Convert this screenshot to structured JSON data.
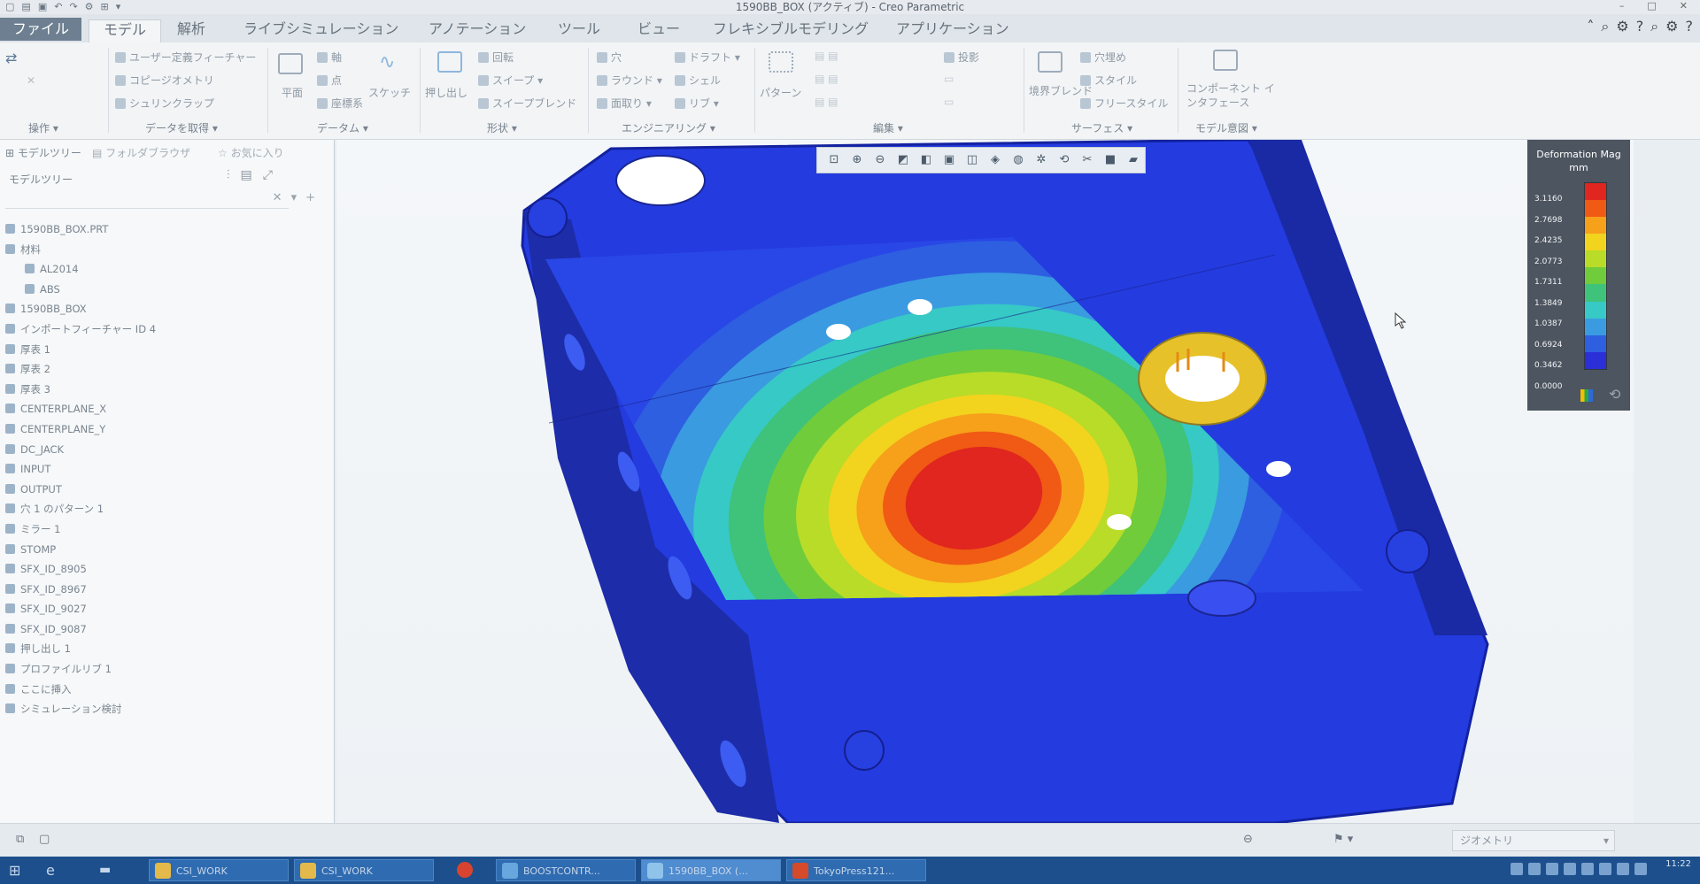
{
  "window": {
    "title": "1590BB_BOX (アクティブ) - Creo Parametric"
  },
  "tabs": [
    {
      "label": "ファイル"
    },
    {
      "label": "モデル"
    },
    {
      "label": "解析"
    },
    {
      "label": "ライブシミュレーション"
    },
    {
      "label": "アノテーション"
    },
    {
      "label": "ツール"
    },
    {
      "label": "ビュー"
    },
    {
      "label": "フレキシブルモデリング"
    },
    {
      "label": "アプリケーション"
    }
  ],
  "ribbon": {
    "items": {
      "user_feature": "ユーザー定義フィーチャー",
      "copy_geometry": "コピージオメトリ",
      "shrinkwrap": "シュリンクラップ",
      "plane": "平面",
      "axis": "軸",
      "point": "点",
      "csys": "座標系",
      "sketch": "スケッチ",
      "extrude": "押し出し",
      "revolve": "回転",
      "sweep": "スイープ",
      "swept_blend": "スイープブレンド",
      "hole": "穴",
      "draft": "ドラフト",
      "round": "ラウンド",
      "shell": "シェル",
      "chamfer": "面取り",
      "rib": "リブ",
      "pattern": "パターン",
      "project": "投影",
      "fill": "穴埋め",
      "style": "スタイル",
      "freestyle": "フリースタイル",
      "boundary_blend": "境界ブレンド",
      "component_interface": "コンポーネント インタフェース"
    },
    "groups": {
      "operations": "操作",
      "get_data": "データを取得",
      "datum": "データム",
      "shapes": "形状",
      "engineering": "エンジニアリング",
      "editing": "編集",
      "surfaces": "サーフェス",
      "model_intent": "モデル意図"
    }
  },
  "left_panel": {
    "tabs": [
      "モデルツリー",
      "フォルダブラウザ",
      "お気に入り"
    ],
    "header": "モデルツリー",
    "items": [
      "1590BB_BOX.PRT",
      "材料",
      "AL2014",
      "ABS",
      "1590BB_BOX",
      "インポートフィーチャー ID 4",
      "厚表 1",
      "厚表 2",
      "厚表 3",
      "CENTERPLANE_X",
      "CENTERPLANE_Y",
      "DC_JACK",
      "INPUT",
      "OUTPUT",
      "穴 1 のパターン 1",
      "ミラー 1",
      "STOMP",
      "SFX_ID_8905",
      "SFX_ID_8967",
      "SFX_ID_9027",
      "SFX_ID_9087",
      "押し出し 1",
      "プロファイルリブ 1",
      "ここに挿入",
      "シミュレーション検討"
    ]
  },
  "legend": {
    "title": "Deformation Mag",
    "unit": "mm",
    "ticks": [
      "3.1160",
      "2.7698",
      "2.4235",
      "2.0773",
      "1.7311",
      "1.3849",
      "1.0387",
      "0.6924",
      "0.3462",
      "0.0000"
    ],
    "colors": [
      "#e0261e",
      "#f05a14",
      "#f7a01a",
      "#f2d31e",
      "#b8dc28",
      "#70cc3a",
      "#3fc27a",
      "#36c9c6",
      "#3a9be0",
      "#2d5fe0",
      "#2a2fd8"
    ]
  },
  "status": {
    "filter": "ジオメトリ"
  },
  "taskbar": {
    "buttons": [
      "CSI_WORK",
      "CSI_WORK",
      "BOOSTCONTR...",
      "1590BB_BOX (...",
      "TokyoPress121..."
    ],
    "clock_time": "11:22"
  }
}
